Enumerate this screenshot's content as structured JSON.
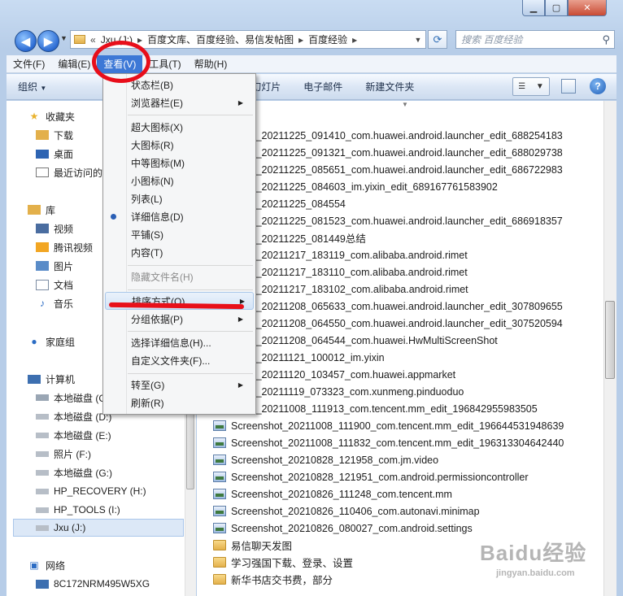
{
  "address": {
    "prefix": "«",
    "part1": "Jxu (J:)",
    "part2": "百度文库、百度经验、易信发帖图",
    "part3": "百度经验"
  },
  "search": {
    "placeholder": "搜索 百度经验"
  },
  "menubar": [
    "文件(F)",
    "编辑(E)",
    "查看(V)",
    "工具(T)",
    "帮助(H)"
  ],
  "cmdbar": {
    "organize": "组织",
    "slideshow": "放映幻灯片",
    "email": "电子邮件",
    "new_folder": "新建文件夹"
  },
  "navpane": {
    "favorites": "收藏夹",
    "downloads": "下载",
    "desktop": "桌面",
    "recent": "最近访问的",
    "libraries": "库",
    "videos": "视频",
    "tencent_video": "腾讯视频",
    "pictures": "图片",
    "documents": "文档",
    "music": "音乐",
    "homegroup": "家庭组",
    "computer": "计算机",
    "drive_c": "本地磁盘 (C",
    "drive_d": "本地磁盘 (D:)",
    "drive_e": "本地磁盘 (E:)",
    "drive_f": "照片 (F:)",
    "drive_g": "本地磁盘 (G:)",
    "drive_h": "HP_RECOVERY (H:)",
    "drive_i": "HP_TOOLS (I:)",
    "drive_j": "Jxu (J:)",
    "network": "网络",
    "net_pc": "8C172NRM495W5XG"
  },
  "files": [
    "nshot_20211225_091410_com.huawei.android.launcher_edit_688254183",
    "nshot_20211225_091321_com.huawei.android.launcher_edit_688029738",
    "nshot_20211225_085651_com.huawei.android.launcher_edit_686722983",
    "nshot_20211225_084603_im.yixin_edit_689167761583902",
    "nshot_20211225_084554",
    "nshot_20211225_081523_com.huawei.android.launcher_edit_686918357",
    "nshot_20211225_081449总结",
    "nshot_20211217_183119_com.alibaba.android.rimet",
    "nshot_20211217_183110_com.alibaba.android.rimet",
    "nshot_20211217_183102_com.alibaba.android.rimet",
    "nshot_20211208_065633_com.huawei.android.launcher_edit_307809655",
    "nshot_20211208_064550_com.huawei.android.launcher_edit_307520594",
    "nshot_20211208_064544_com.huawei.HwMultiScreenShot",
    "nshot_20211121_100012_im.yixin",
    "nshot_20211120_103457_com.huawei.appmarket",
    "nshot_20211119_073323_com.xunmeng.pinduoduo",
    "nshot_20211008_111913_com.tencent.mm_edit_196842955983505",
    "Screenshot_20211008_111900_com.tencent.mm_edit_196644531948639",
    "Screenshot_20211008_111832_com.tencent.mm_edit_196313304642440",
    "Screenshot_20210828_121958_com.jm.video",
    "Screenshot_20210828_121951_com.android.permissioncontroller",
    "Screenshot_20210826_111248_com.tencent.mm",
    "Screenshot_20210826_110406_com.autonavi.minimap",
    "Screenshot_20210826_080027_com.android.settings"
  ],
  "folders": [
    "易信聊天发图",
    "学习强国下载、登录、设置",
    "新华书店交书费，部分"
  ],
  "menu": {
    "status_bar": "状态栏(B)",
    "explorer_bar": "浏览器栏(E)",
    "xlarge_icons": "超大图标(X)",
    "large_icons": "大图标(R)",
    "medium_icons": "中等图标(M)",
    "small_icons": "小图标(N)",
    "list": "列表(L)",
    "details": "详细信息(D)",
    "tiles": "平铺(S)",
    "content": "内容(T)",
    "hide_ext": "隐藏文件名(H)",
    "sort_by": "排序方式(O)",
    "group_by": "分组依据(P)",
    "choose_details": "选择详细信息(H)...",
    "customize": "自定义文件夹(F)...",
    "go_to": "转至(G)",
    "refresh": "刷新(R)"
  },
  "watermark": {
    "logo": "Baidu经验",
    "url": "jingyan.baidu.com"
  },
  "colors": {
    "menu_highlight": "#3d78d6",
    "annotation_red": "#e80e1a"
  }
}
